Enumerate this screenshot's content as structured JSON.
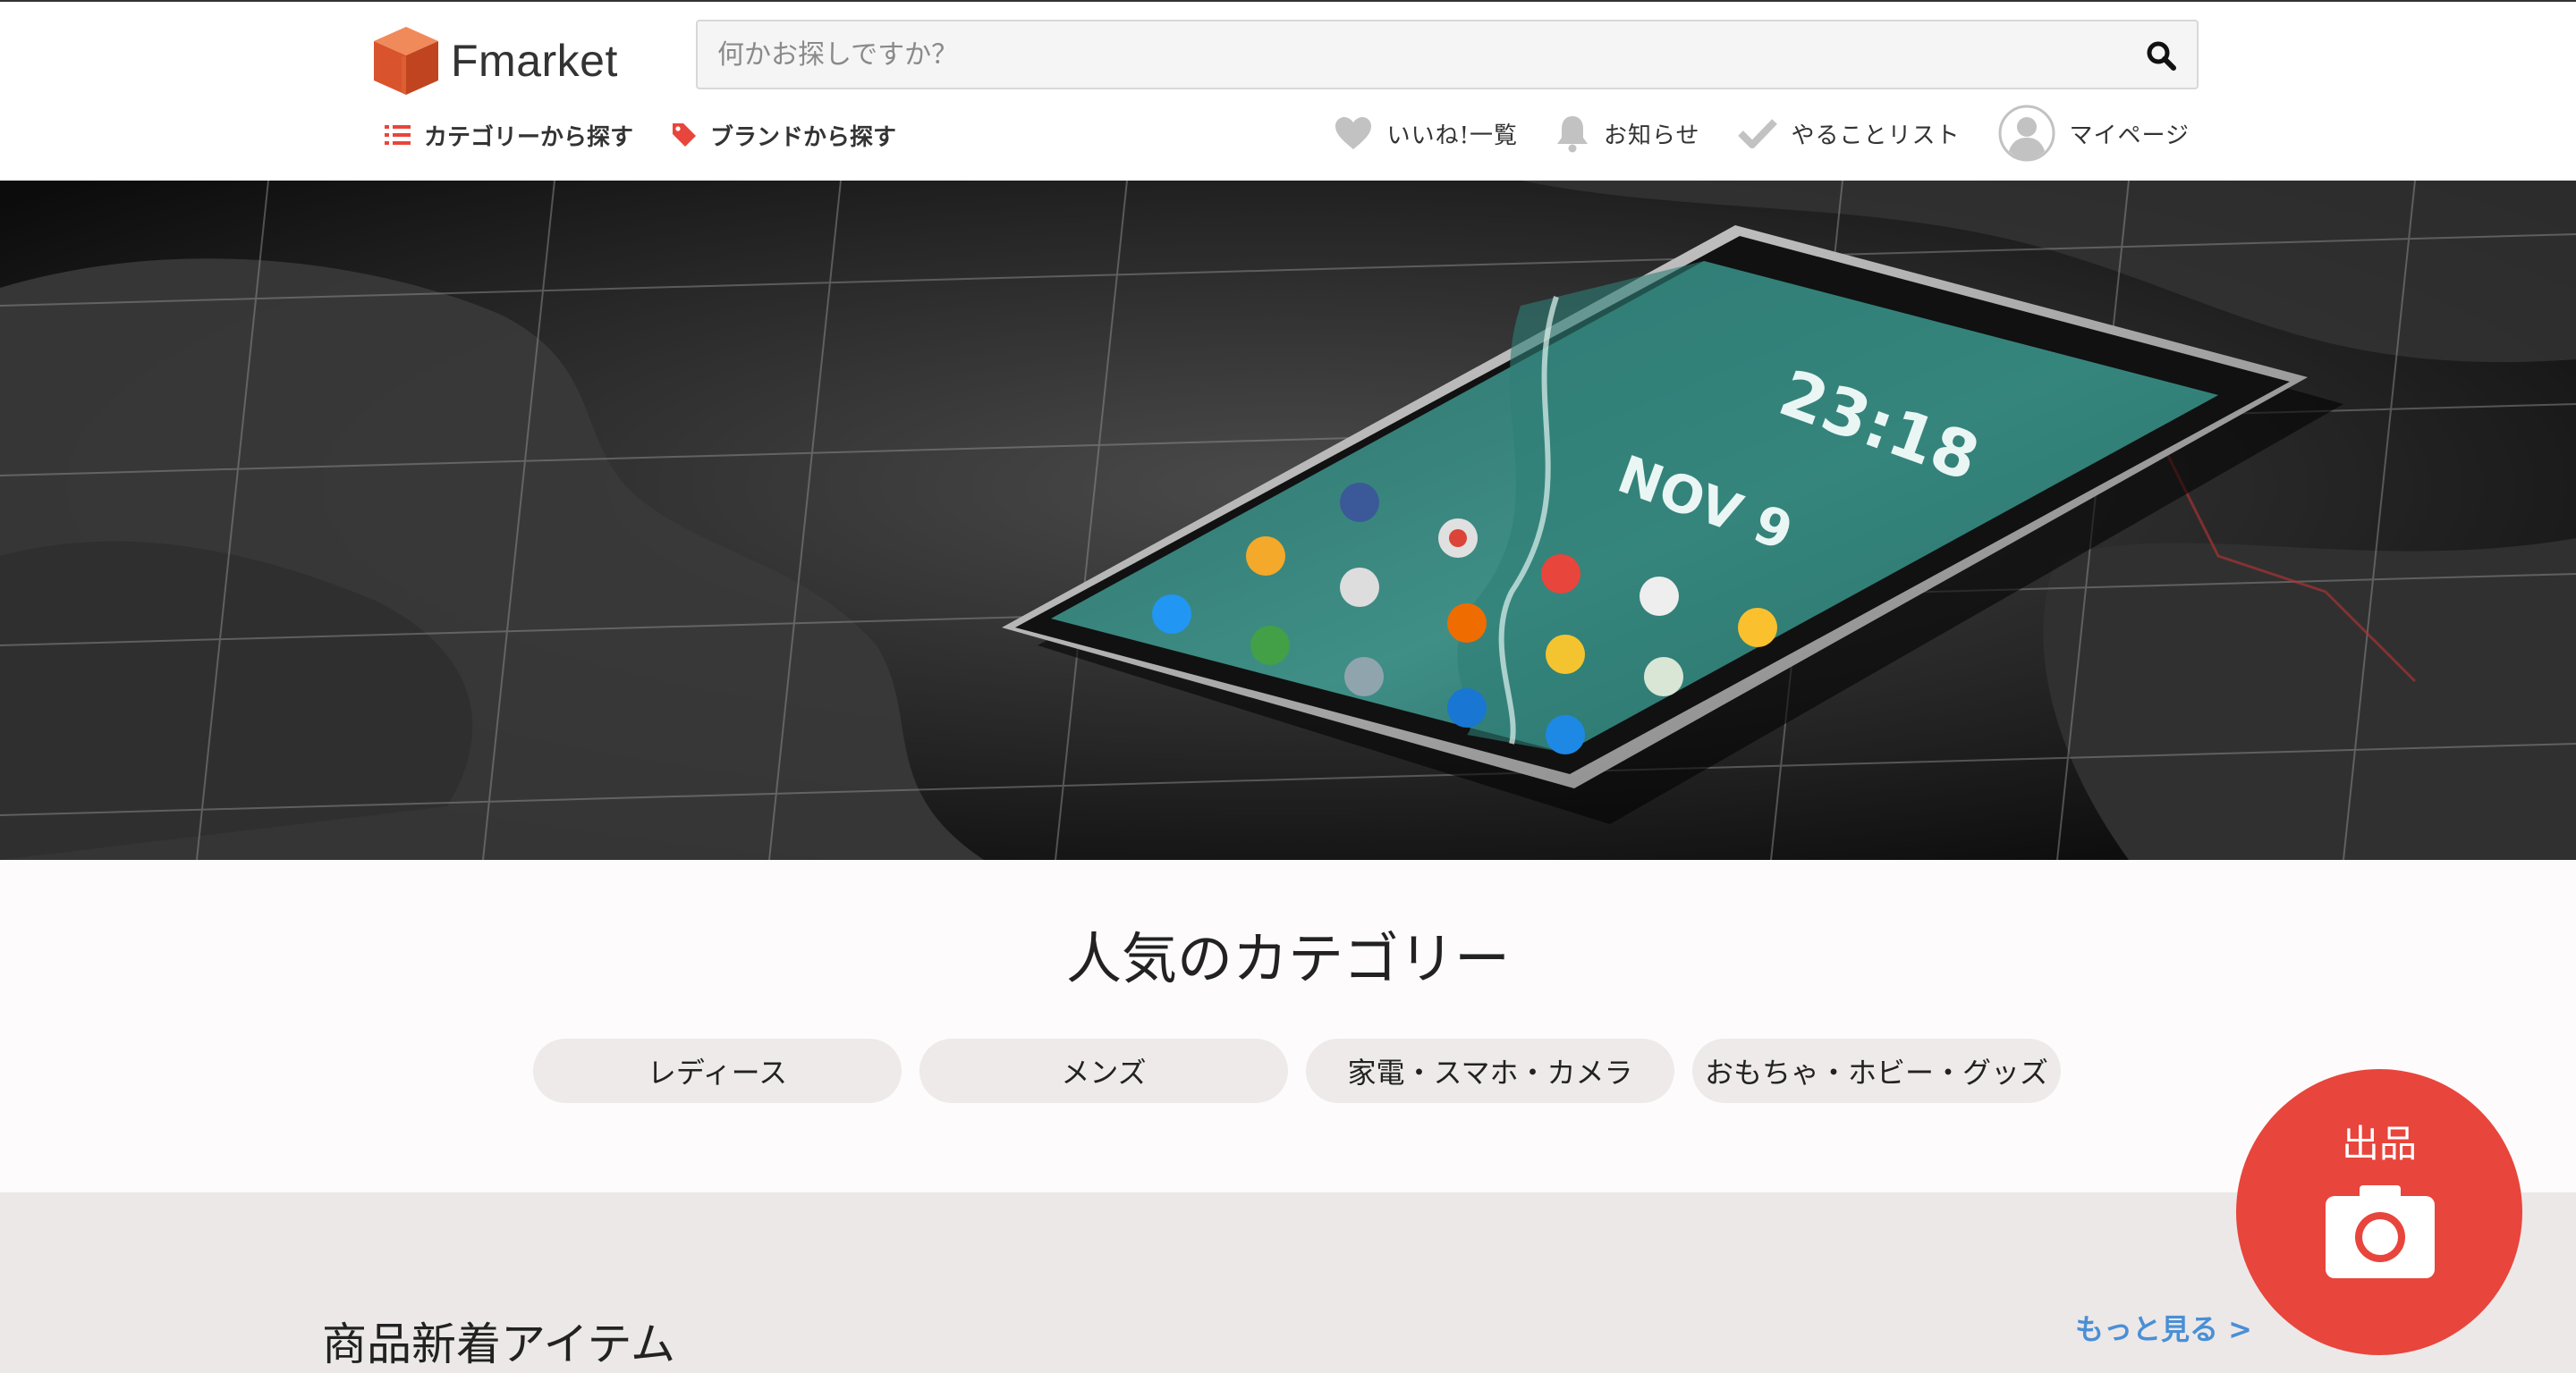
{
  "brand": {
    "name": "Fmarket",
    "logo_color": "#e06a3a"
  },
  "search": {
    "placeholder": "何かお探しですか？",
    "value": ""
  },
  "subnav": {
    "category_label": "カテゴリーから探す",
    "brand_label": "ブランドから探す"
  },
  "usernav": {
    "likes_label": "いいね!一覧",
    "notifications_label": "お知らせ",
    "todo_label": "やることリスト",
    "mypage_label": "マイページ"
  },
  "categories": {
    "title": "人気のカテゴリー",
    "items": [
      {
        "label": "レディース"
      },
      {
        "label": "メンズ"
      },
      {
        "label": "家電・スマホ・カメラ"
      },
      {
        "label": "おもちゃ・ホビー・グッズ"
      }
    ]
  },
  "new_items": {
    "title": "商品新着アイテム",
    "more_label": "もっと見る >"
  },
  "sell": {
    "label": "出品"
  },
  "colors": {
    "accent_red": "#e8453c",
    "link_blue": "#4a8fd6",
    "icon_grey": "#b0b0b0"
  }
}
